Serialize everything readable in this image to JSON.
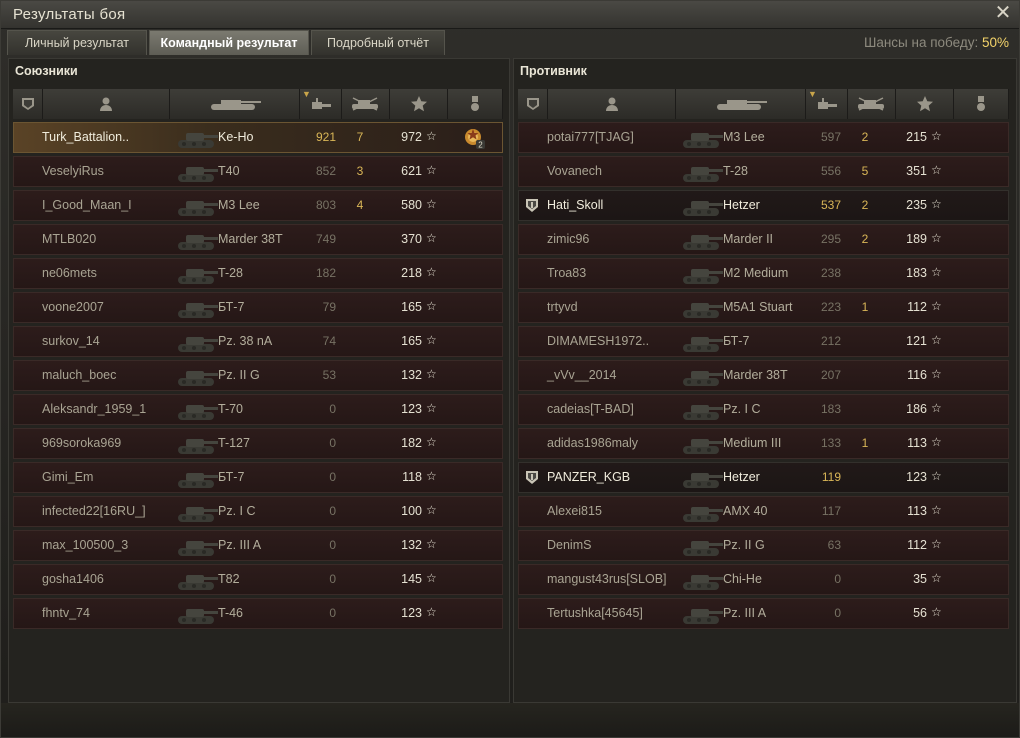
{
  "window": {
    "title": "Результаты боя",
    "close_icon": "close-icon"
  },
  "tabs": [
    {
      "label": "Личный результат",
      "active": false
    },
    {
      "label": "Командный результат",
      "active": true
    },
    {
      "label": "Подробный отчёт",
      "active": false
    }
  ],
  "chance": {
    "label": "Шансы на победу:",
    "value": "50%"
  },
  "allies": {
    "title": "Союзники",
    "rows": [
      {
        "name": "Turk_Battalion..",
        "vehicle": "Ke-Ho",
        "damage": "921",
        "kills": "7",
        "xp": "972",
        "state": "me",
        "medal": "2"
      },
      {
        "name": "VeselyiRus",
        "vehicle": "T40",
        "damage": "852",
        "kills": "3",
        "xp": "621"
      },
      {
        "name": "I_Good_Maan_I",
        "vehicle": "M3 Lee",
        "damage": "803",
        "kills": "4",
        "xp": "580"
      },
      {
        "name": "MTLB020",
        "vehicle": "Marder 38T",
        "damage": "749",
        "kills": "",
        "xp": "370"
      },
      {
        "name": "ne06mets",
        "vehicle": "T-28",
        "damage": "182",
        "kills": "",
        "xp": "218"
      },
      {
        "name": "voone2007",
        "vehicle": "БТ-7",
        "damage": "79",
        "kills": "",
        "xp": "165"
      },
      {
        "name": "surkov_14",
        "vehicle": "Pz. 38 nA",
        "damage": "74",
        "kills": "",
        "xp": "165"
      },
      {
        "name": "maluch_boec",
        "vehicle": "Pz. II G",
        "damage": "53",
        "kills": "",
        "xp": "132"
      },
      {
        "name": "Aleksandr_1959_1",
        "vehicle": "T-70",
        "damage": "0",
        "kills": "",
        "xp": "123"
      },
      {
        "name": "969soroka969",
        "vehicle": "T-127",
        "damage": "0",
        "kills": "",
        "xp": "182"
      },
      {
        "name": "Gimi_Em",
        "vehicle": "БТ-7",
        "damage": "0",
        "kills": "",
        "xp": "118"
      },
      {
        "name": "infected22[16RU_]",
        "vehicle": "Pz. I C",
        "damage": "0",
        "kills": "",
        "xp": "100"
      },
      {
        "name": "max_100500_3",
        "vehicle": "Pz. III A",
        "damage": "0",
        "kills": "",
        "xp": "132"
      },
      {
        "name": "gosha1406",
        "vehicle": "T82",
        "damage": "0",
        "kills": "",
        "xp": "145"
      },
      {
        "name": "fhntv_74",
        "vehicle": "T-46",
        "damage": "0",
        "kills": "",
        "xp": "123"
      }
    ]
  },
  "enemies": {
    "title": "Противник",
    "rows": [
      {
        "name": "potai777[TJAG]",
        "vehicle": "M3 Lee",
        "damage": "597",
        "kills": "2",
        "xp": "215"
      },
      {
        "name": "Vovanech",
        "vehicle": "T-28",
        "damage": "556",
        "kills": "5",
        "xp": "351"
      },
      {
        "name": "Hati_Skoll",
        "vehicle": "Hetzer",
        "damage": "537",
        "kills": "2",
        "xp": "235",
        "state": "squad"
      },
      {
        "name": "zimic96",
        "vehicle": "Marder II",
        "damage": "295",
        "kills": "2",
        "xp": "189"
      },
      {
        "name": "Troa83",
        "vehicle": "M2 Medium",
        "damage": "238",
        "kills": "",
        "xp": "183"
      },
      {
        "name": "trtyvd",
        "vehicle": "M5A1 Stuart",
        "damage": "223",
        "kills": "1",
        "xp": "112"
      },
      {
        "name": "DIMAMESH1972..",
        "vehicle": "БТ-7",
        "damage": "212",
        "kills": "",
        "xp": "121"
      },
      {
        "name": "_vVv__2014",
        "vehicle": "Marder 38T",
        "damage": "207",
        "kills": "",
        "xp": "116"
      },
      {
        "name": "cadeias[T-BAD]",
        "vehicle": "Pz. I C",
        "damage": "183",
        "kills": "",
        "xp": "186"
      },
      {
        "name": "adidas1986maly",
        "vehicle": "Medium III",
        "damage": "133",
        "kills": "1",
        "xp": "113"
      },
      {
        "name": "PANZER_KGB",
        "vehicle": "Hetzer",
        "damage": "119",
        "kills": "",
        "xp": "123",
        "state": "squad"
      },
      {
        "name": "Alexei815",
        "vehicle": "AMX 40",
        "damage": "117",
        "kills": "",
        "xp": "113"
      },
      {
        "name": "DenimS",
        "vehicle": "Pz. II G",
        "damage": "63",
        "kills": "",
        "xp": "112"
      },
      {
        "name": "mangust43rus[SLOB]",
        "vehicle": "Chi-He",
        "damage": "0",
        "kills": "",
        "xp": "35"
      },
      {
        "name": "Tertushka[45645]",
        "vehicle": "Pz. III A",
        "damage": "0",
        "kills": "",
        "xp": "56"
      }
    ]
  },
  "columns": [
    "squad-icon",
    "player-icon",
    "tank-icon",
    "damage-icon",
    "kills-icon",
    "xp-star-icon",
    "medal-icon"
  ],
  "star_glyph": "☆"
}
